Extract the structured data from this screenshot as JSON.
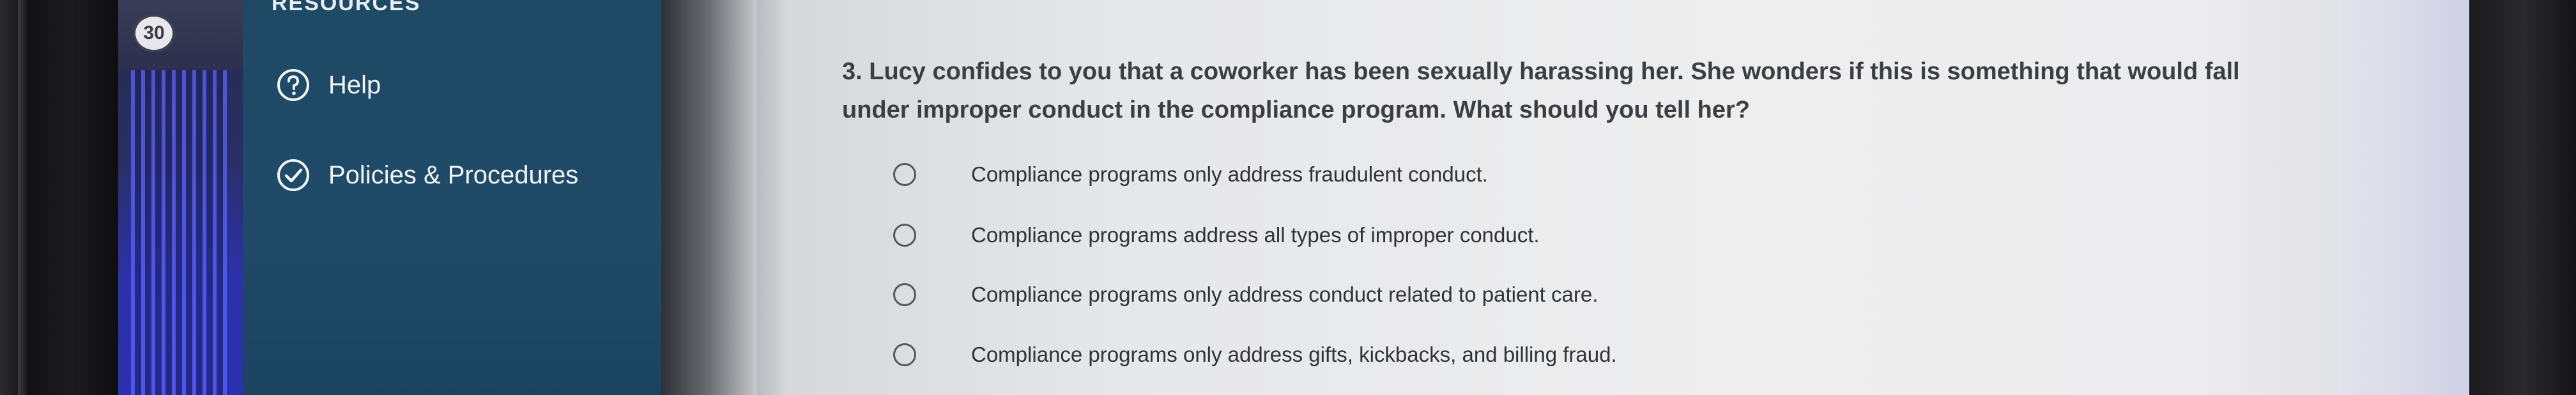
{
  "step_badge": "30",
  "sidebar": {
    "heading": "RESOURCES",
    "items": [
      {
        "label": "Help",
        "icon": "question-circle-icon"
      },
      {
        "label": "Policies & Procedures",
        "icon": "check-circle-icon"
      }
    ]
  },
  "question": {
    "text": "3. Lucy confides to you that a coworker has been sexually harassing her. She wonders if this is something that would fall under improper conduct in the compliance program. What should you tell her?",
    "options": [
      {
        "label": "Compliance programs only address fraudulent conduct."
      },
      {
        "label": "Compliance programs address all types of improper conduct."
      },
      {
        "label": "Compliance programs only address conduct related to patient care."
      },
      {
        "label": "Compliance programs only address gifts, kickbacks, and billing fraud."
      }
    ]
  },
  "colors": {
    "sidebar_bg": "#1f4a68",
    "content_bg": "#ececee",
    "question_text": "#3b3f44"
  }
}
